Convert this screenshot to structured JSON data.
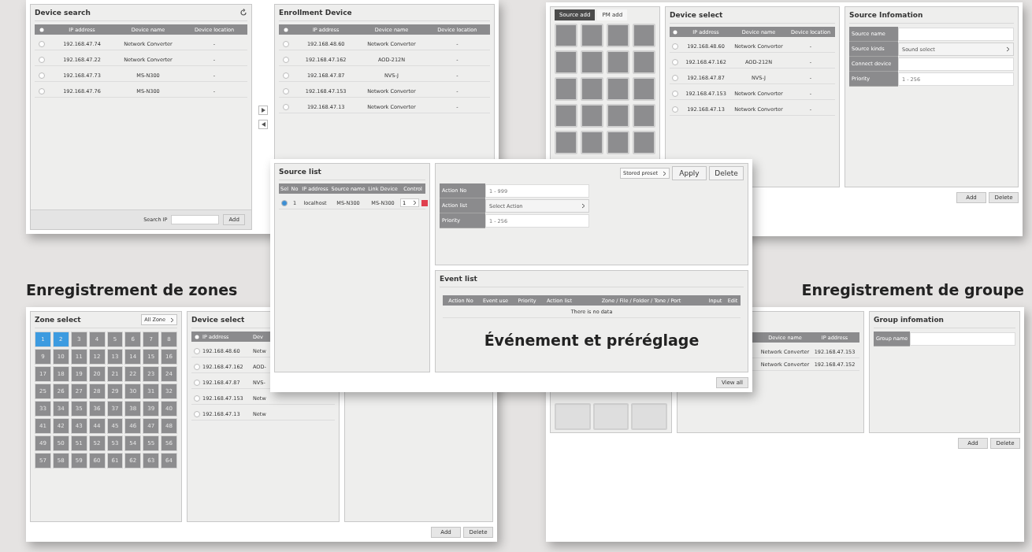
{
  "device_window": {
    "search_panel": {
      "title": "Device search",
      "columns": [
        "IP address",
        "Device name",
        "Device location"
      ],
      "rows": [
        {
          "checked": false,
          "cells": [
            "192.168.47.74",
            "Network Converter",
            "-"
          ]
        },
        {
          "checked": false,
          "cells": [
            "192.168.47.22",
            "Network Converter",
            "-"
          ]
        },
        {
          "checked": false,
          "cells": [
            "192.168.47.73",
            "MS-N300",
            "-"
          ]
        },
        {
          "checked": false,
          "cells": [
            "192.168.47.76",
            "MS-N300",
            "-"
          ]
        }
      ],
      "search_label": "Search IP",
      "add_button": "Add"
    },
    "enrollment_panel": {
      "title": "Enrollment Device",
      "columns": [
        "IP address",
        "Device name",
        "Device location"
      ],
      "rows": [
        {
          "checked": false,
          "cells": [
            "192.168.48.60",
            "Network Converter",
            "-"
          ]
        },
        {
          "checked": false,
          "cells": [
            "192.168.47.162",
            "AOD-212N",
            "-"
          ]
        },
        {
          "checked": false,
          "cells": [
            "192.168.47.87",
            "NVS-J",
            "-"
          ]
        },
        {
          "checked": false,
          "cells": [
            "192.168.47.153",
            "Network Converter",
            "-"
          ]
        },
        {
          "checked": false,
          "cells": [
            "192.168.47.13",
            "Network Converter",
            "-"
          ]
        }
      ]
    }
  },
  "source_window": {
    "tabs": [
      {
        "label": "Source add",
        "selected": true
      },
      {
        "label": "PM add",
        "selected": false
      }
    ],
    "device_select": {
      "title": "Device select",
      "columns": [
        "IP address",
        "Device name",
        "Device location"
      ],
      "rows": [
        {
          "checked": false,
          "cells": [
            "192.168.48.60",
            "Network Converter",
            "-"
          ]
        },
        {
          "checked": false,
          "cells": [
            "192.168.47.162",
            "AOD-212N",
            "-"
          ]
        },
        {
          "checked": false,
          "cells": [
            "192.168.47.87",
            "NVS-J",
            "-"
          ]
        },
        {
          "checked": false,
          "cells": [
            "192.168.47.153",
            "Network Converter",
            "-"
          ]
        },
        {
          "checked": false,
          "cells": [
            "192.168.47.13",
            "Network Converter",
            "-"
          ]
        }
      ]
    },
    "source_info": {
      "title": "Source Infomation",
      "fields": [
        {
          "kind": "input",
          "label": "Source name"
        },
        {
          "kind": "select",
          "label": "Source kinds",
          "value": "Sound select"
        },
        {
          "kind": "input",
          "label": "Connect device"
        },
        {
          "kind": "input",
          "label": "Priority",
          "placeholder": "1 - 256"
        }
      ]
    },
    "buttons": [
      "Add",
      "Delete"
    ]
  },
  "event_window": {
    "source_list": {
      "title": "Source list",
      "columns": [
        "Sel",
        "No",
        "IP address",
        "Source name",
        "Link Device",
        "Control"
      ],
      "rows": [
        {
          "selected": true,
          "no": "1",
          "ip": "localhost",
          "source": "MS-N300",
          "link": "MS-N300",
          "control_value": "1"
        }
      ]
    },
    "preset_select": "Stored preset",
    "apply_button": "Apply",
    "delete_button": "Delete",
    "fields": [
      {
        "kind": "input",
        "label": "Action No",
        "placeholder": "1 - 999"
      },
      {
        "kind": "select",
        "label": "Action list",
        "value": "Select Action"
      },
      {
        "kind": "input",
        "label": "Priority",
        "placeholder": "1 - 256"
      }
    ],
    "event_list": {
      "title": "Event list",
      "columns": [
        "Action No",
        "Event use",
        "Priority",
        "Action list",
        "Zone / File / Folder / Tone / Port",
        "Input",
        "Edit"
      ],
      "empty": "There is no data"
    },
    "caption": "Événement et préréglage",
    "view_all_button": "View all"
  },
  "zone_window": {
    "caption": "Enregistrement de zones",
    "zone_select": {
      "title": "Zone select",
      "dropdown": "All Zone",
      "zones": [
        {
          "label": "1",
          "selected": true
        },
        {
          "label": "2",
          "selected": true
        },
        {
          "label": "3",
          "selected": false
        },
        {
          "label": "4",
          "selected": false
        },
        {
          "label": "5",
          "selected": false
        },
        {
          "label": "6",
          "selected": false
        },
        {
          "label": "7",
          "selected": false
        },
        {
          "label": "8",
          "selected": false
        },
        {
          "label": "9",
          "selected": false
        },
        {
          "label": "10",
          "selected": false
        },
        {
          "label": "11",
          "selected": false
        },
        {
          "label": "12",
          "selected": false
        },
        {
          "label": "13",
          "selected": false
        },
        {
          "label": "14",
          "selected": false
        },
        {
          "label": "15",
          "selected": false
        },
        {
          "label": "16",
          "selected": false
        },
        {
          "label": "17",
          "selected": false
        },
        {
          "label": "18",
          "selected": false
        },
        {
          "label": "19",
          "selected": false
        },
        {
          "label": "20",
          "selected": false
        },
        {
          "label": "21",
          "selected": false
        },
        {
          "label": "22",
          "selected": false
        },
        {
          "label": "23",
          "selected": false
        },
        {
          "label": "24",
          "selected": false
        },
        {
          "label": "25",
          "selected": false
        },
        {
          "label": "26",
          "selected": false
        },
        {
          "label": "27",
          "selected": false
        },
        {
          "label": "28",
          "selected": false
        },
        {
          "label": "29",
          "selected": false
        },
        {
          "label": "30",
          "selected": false
        },
        {
          "label": "31",
          "selected": false
        },
        {
          "label": "32",
          "selected": false
        },
        {
          "label": "33",
          "selected": false
        },
        {
          "label": "34",
          "selected": false
        },
        {
          "label": "35",
          "selected": false
        },
        {
          "label": "36",
          "selected": false
        },
        {
          "label": "37",
          "selected": false
        },
        {
          "label": "38",
          "selected": false
        },
        {
          "label": "39",
          "selected": false
        },
        {
          "label": "40",
          "selected": false
        },
        {
          "label": "41",
          "selected": false
        },
        {
          "label": "42",
          "selected": false
        },
        {
          "label": "43",
          "selected": false
        },
        {
          "label": "44",
          "selected": false
        },
        {
          "label": "45",
          "selected": false
        },
        {
          "label": "46",
          "selected": false
        },
        {
          "label": "47",
          "selected": false
        },
        {
          "label": "48",
          "selected": false
        },
        {
          "label": "49",
          "selected": false
        },
        {
          "label": "50",
          "selected": false
        },
        {
          "label": "51",
          "selected": false
        },
        {
          "label": "52",
          "selected": false
        },
        {
          "label": "53",
          "selected": false
        },
        {
          "label": "54",
          "selected": false
        },
        {
          "label": "55",
          "selected": false
        },
        {
          "label": "56",
          "selected": false
        },
        {
          "label": "57",
          "selected": false
        },
        {
          "label": "58",
          "selected": false
        },
        {
          "label": "59",
          "selected": false
        },
        {
          "label": "60",
          "selected": false
        },
        {
          "label": "61",
          "selected": false
        },
        {
          "label": "62",
          "selected": false
        },
        {
          "label": "63",
          "selected": false
        },
        {
          "label": "64",
          "selected": false
        }
      ]
    },
    "device_select": {
      "title": "Device select",
      "columns": [
        "IP address",
        "Dev"
      ],
      "rows": [
        {
          "checked": false,
          "cells": [
            "192.168.48.60",
            "Netw"
          ]
        },
        {
          "checked": false,
          "cells": [
            "192.168.47.162",
            "AOD-"
          ]
        },
        {
          "checked": false,
          "cells": [
            "192.168.47.87",
            "NVS-"
          ]
        },
        {
          "checked": false,
          "cells": [
            "192.168.47.153",
            "Netw"
          ]
        },
        {
          "checked": false,
          "cells": [
            "192.168.47.13",
            "Netw"
          ]
        }
      ]
    },
    "buttons": [
      "Add",
      "Delete"
    ]
  },
  "group_window": {
    "caption": "Enregistrement de groupe",
    "device_panel": {
      "columns": [
        "Device name",
        "IP address"
      ],
      "rows": [
        {
          "cells": [
            "Network Converter",
            "192.168.47.153"
          ]
        },
        {
          "cells": [
            "Network Converter",
            "192.168.47.152"
          ]
        }
      ]
    },
    "group_info": {
      "title": "Group infomation",
      "field_label": "Group name"
    },
    "buttons": [
      "Add",
      "Delete"
    ]
  }
}
